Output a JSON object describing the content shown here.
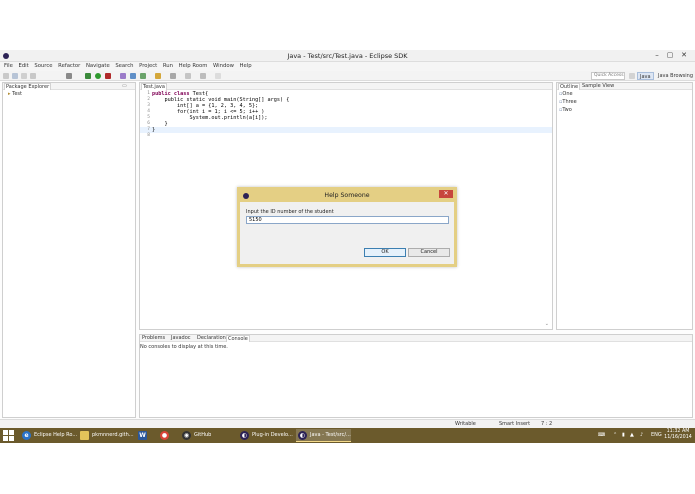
{
  "window": {
    "title": "Java - Test/src/Test.java - Eclipse SDK"
  },
  "menu": [
    "File",
    "Edit",
    "Source",
    "Refactor",
    "Navigate",
    "Search",
    "Project",
    "Run",
    "Help Room",
    "Window",
    "Help"
  ],
  "toolbar": {
    "quick_access": "Quick Access",
    "perspectives": [
      "Java",
      "Java Browsing"
    ]
  },
  "package_explorer": {
    "tab": "Package Explorer",
    "items": [
      "Test"
    ]
  },
  "editor": {
    "tab": "Test.java",
    "line_numbers": [
      "1",
      "2",
      "3",
      "4",
      "5",
      "6",
      "7",
      "8"
    ],
    "lines": [
      "public class Test{",
      "    public static void main(String[] args) {",
      "        int[] a = {1, 2, 3, 4, 5};",
      "        for(int i = 1; i <= 5; i++ )",
      "            System.out.println(a[i]);",
      "    }",
      "}",
      ""
    ]
  },
  "outline": {
    "tabs": [
      "Outline",
      "Sample View"
    ],
    "items": [
      "One",
      "Three",
      "Two"
    ]
  },
  "bottom_panel": {
    "tabs": [
      "Problems",
      "Javadoc",
      "Declaration",
      "Console"
    ],
    "message": "No consoles to display at this time."
  },
  "status_bar": {
    "writable": "Writable",
    "insert_mode": "Smart Insert",
    "position": "7 : 2"
  },
  "dialog": {
    "title": "Help Someone",
    "prompt": "Input the ID number of the student",
    "value": "5150",
    "ok": "OK",
    "cancel": "Cancel"
  },
  "taskbar": {
    "tasks": [
      "Eclipse Help Ro...",
      "pkmnnerd.gith...",
      "GitHub",
      "Plug-in Develo...",
      "Java - Test/src/..."
    ],
    "language": "ENG",
    "time": "11:32 AM",
    "date": "11/16/2014"
  },
  "colors": {
    "dialog_border": "#e4cf84",
    "taskbar": "#6b5a2c",
    "keyword": "#7f0055",
    "field": "#0000c0"
  }
}
